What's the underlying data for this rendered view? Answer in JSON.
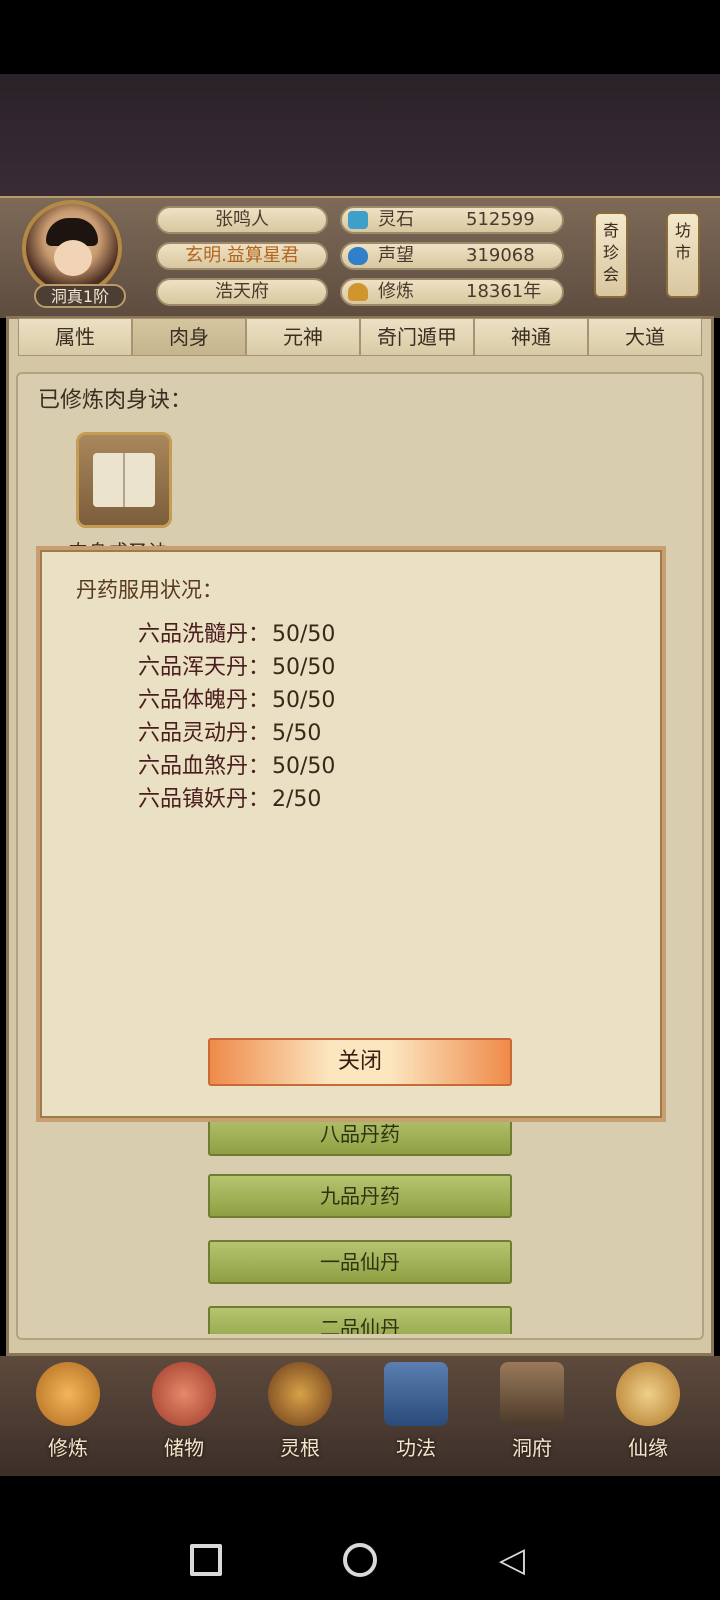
{
  "header": {
    "rank": "洞真1阶",
    "player_name": "张鸣人",
    "player_title": "玄明.益算星君",
    "residence": "浩天府",
    "stats": [
      {
        "label": "灵石",
        "value": "512599",
        "icon": "spirit-stone-icon",
        "color": "#3ea0c8"
      },
      {
        "label": "声望",
        "value": "319068",
        "icon": "reputation-icon",
        "color": "#2f7fc9"
      },
      {
        "label": "修炼",
        "value": "18361年",
        "icon": "meditation-icon",
        "color": "#d1952e"
      }
    ],
    "side_buttons": [
      "奇珍会",
      "坊市"
    ]
  },
  "tabs": [
    "属性",
    "肉身",
    "元神",
    "奇门遁甲",
    "神通",
    "大道"
  ],
  "active_tab": "肉身",
  "content": {
    "heading": "已修炼肉身诀：",
    "book_label": "肉身成圣诀",
    "list_buttons": [
      "八品丹药",
      "九品丹药",
      "一品仙丹",
      "二品仙丹"
    ]
  },
  "modal": {
    "title": "丹药服用状况：",
    "items": [
      {
        "name": "六品洗髓丹：",
        "count": "50/50"
      },
      {
        "name": "六品浑天丹：",
        "count": "50/50"
      },
      {
        "name": "六品体魄丹：",
        "count": "50/50"
      },
      {
        "name": "六品灵动丹：",
        "count": "5/50"
      },
      {
        "name": "六品血煞丹：",
        "count": "50/50"
      },
      {
        "name": "六品镇妖丹：",
        "count": "2/50"
      }
    ],
    "close_label": "关闭"
  },
  "bottom_nav": [
    {
      "label": "修炼",
      "icon": "cultivate-icon"
    },
    {
      "label": "储物",
      "icon": "storage-bag-icon"
    },
    {
      "label": "灵根",
      "icon": "spirit-root-icon"
    },
    {
      "label": "功法",
      "icon": "technique-book-icon"
    },
    {
      "label": "洞府",
      "icon": "cave-abode-icon"
    },
    {
      "label": "仙缘",
      "icon": "immortal-fate-icon"
    }
  ]
}
